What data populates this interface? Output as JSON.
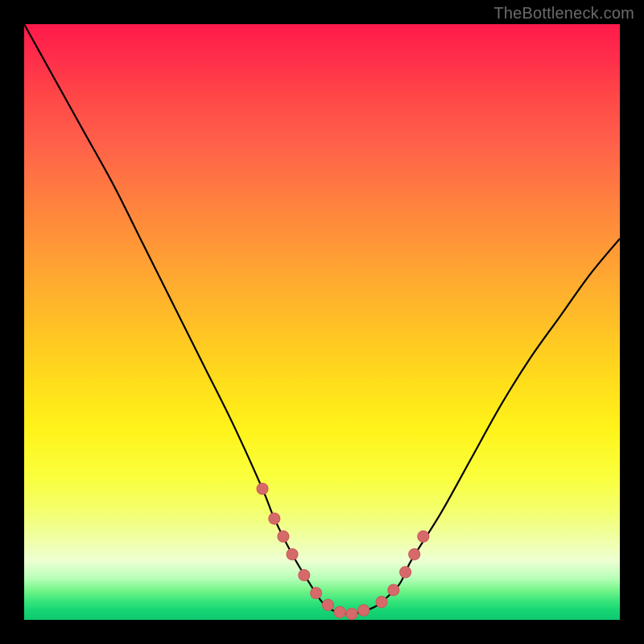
{
  "watermark": "TheBottleneck.com",
  "colors": {
    "frame": "#000000",
    "curve": "#000000",
    "marker_fill": "#d66a6a",
    "marker_stroke": "#c95858"
  },
  "chart_data": {
    "type": "line",
    "title": "",
    "xlabel": "",
    "ylabel": "",
    "xlim": [
      0,
      100
    ],
    "ylim": [
      0,
      100
    ],
    "grid": false,
    "legend": false,
    "series": [
      {
        "name": "bottleneck-curve",
        "x": [
          0,
          5,
          10,
          15,
          20,
          25,
          30,
          35,
          40,
          42,
          45,
          48,
          50,
          52,
          55,
          58,
          60,
          63,
          65,
          70,
          75,
          80,
          85,
          90,
          95,
          100
        ],
        "y": [
          100,
          91,
          82,
          73,
          63,
          53,
          43,
          33,
          22,
          17,
          11,
          6,
          3,
          1.5,
          1,
          1.8,
          3,
          6,
          10,
          18,
          27,
          36,
          44,
          51,
          58,
          64
        ]
      }
    ],
    "markers": {
      "name": "highlight-points",
      "x": [
        40,
        42,
        43.5,
        45,
        47,
        49,
        51,
        53,
        55,
        57,
        60,
        62,
        64,
        65.5,
        67
      ],
      "y": [
        22,
        17,
        14,
        11,
        7.5,
        4.5,
        2.5,
        1.3,
        1,
        1.6,
        3,
        5,
        8,
        11,
        14
      ]
    }
  }
}
